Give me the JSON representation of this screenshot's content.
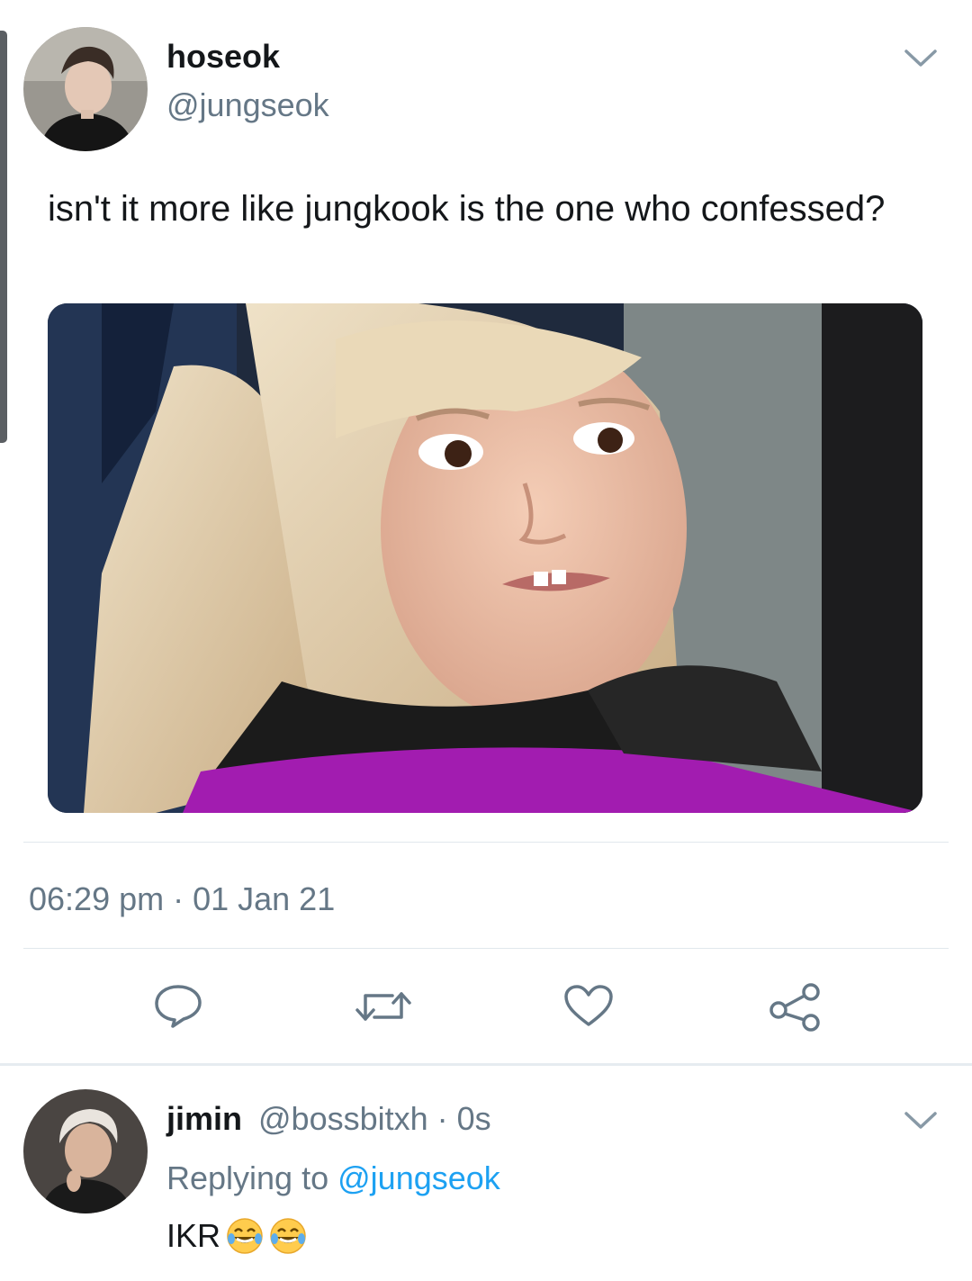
{
  "tweet": {
    "author_name": "hoseok",
    "author_handle": "@jungseok",
    "text": "isn't it more like jungkook is the one who confessed?",
    "image_desc": "meme-photo",
    "timestamp": "06:29 pm · 01 Jan 21",
    "actions": [
      "reply-icon",
      "retweet-icon",
      "like-icon",
      "share-icon"
    ],
    "accent_color": "#1da1f2"
  },
  "reply": {
    "author_name": "jimin",
    "author_handle": "@bossbitxh",
    "time": "· 0s",
    "replying_label": "Replying to",
    "replying_to": "@jungseok",
    "text": "IKR",
    "emojis": [
      "tears-of-joy-emoji",
      "tears-of-joy-emoji"
    ]
  }
}
